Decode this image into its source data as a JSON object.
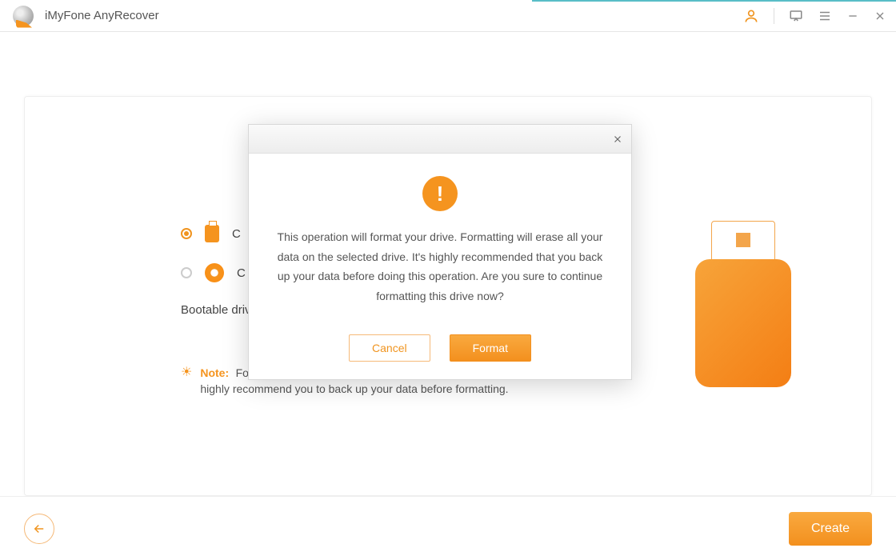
{
  "titlebar": {
    "app_name": "iMyFone AnyRecover"
  },
  "options": {
    "opt1_label": "C",
    "opt2_label": "C"
  },
  "main": {
    "bootable_label": "Bootable driv",
    "note_label": "Note:",
    "note_text": "Formatting will erase all your data on the selected drive. We highly recommend you to back up your data before formatting."
  },
  "bottom": {
    "create_label": "Create"
  },
  "modal": {
    "message": "This operation will format your drive. Formatting will erase all your data on the selected drive. It's highly recommended that you back up your data before doing this operation. Are you sure to continue formatting this drive now?",
    "cancel_label": "Cancel",
    "format_label": "Format",
    "warn_glyph": "!"
  }
}
